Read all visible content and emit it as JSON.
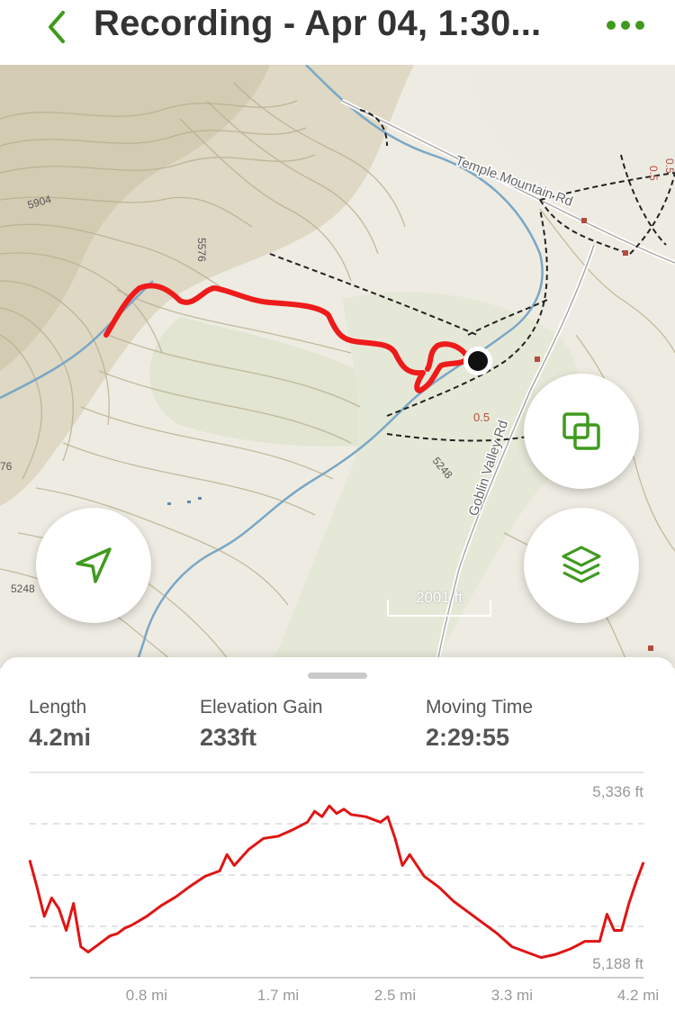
{
  "header": {
    "title": "Recording - Apr 04, 1:30...",
    "accent": "#3f9a1e"
  },
  "map": {
    "labels": {
      "road1": "Temple Mountain Rd",
      "road2": "Goblin Valley Rd",
      "elev1": "5904",
      "elev2": "5576",
      "elev3": "5248",
      "elev4": "5248",
      "elev5": "76",
      "trail_mile1": "0.5",
      "trail_mile2": "0.5",
      "trail_mile3": "0.5"
    },
    "scale": "2001 ft",
    "track_color": "#ee1b1b"
  },
  "stats": [
    {
      "label": "Length",
      "value": "4.2mi"
    },
    {
      "label": "Elevation Gain",
      "value": "233ft"
    },
    {
      "label": "Moving Time",
      "value": "2:29:55"
    }
  ],
  "chart_data": {
    "type": "line",
    "title": "",
    "xlabel": "",
    "ylabel": "",
    "x_ticks": [
      "0.8 mi",
      "1.7 mi",
      "2.5 mi",
      "3.3 mi",
      "4.2 mi"
    ],
    "y_ticks": [
      "5,336 ft",
      "5,188 ft"
    ],
    "ylim": [
      5188,
      5336
    ],
    "xlim": [
      0,
      4.2
    ],
    "series": [
      {
        "x": [
          0,
          0.05,
          0.1,
          0.15,
          0.2,
          0.25,
          0.3,
          0.35,
          0.4,
          0.45,
          0.5,
          0.55,
          0.6,
          0.65,
          0.7,
          0.8,
          0.9,
          1.0,
          1.1,
          1.2,
          1.3,
          1.35,
          1.4,
          1.5,
          1.6,
          1.7,
          1.8,
          1.9,
          1.95,
          2.0,
          2.05,
          2.1,
          2.15,
          2.2,
          2.3,
          2.4,
          2.45,
          2.5,
          2.55,
          2.6,
          2.7,
          2.8,
          2.9,
          3.0,
          3.1,
          3.2,
          3.3,
          3.4,
          3.5,
          3.6,
          3.7,
          3.8,
          3.9,
          3.95,
          4.0,
          4.05,
          4.1,
          4.15,
          4.2
        ],
        "y": [
          5280,
          5255,
          5228,
          5245,
          5235,
          5215,
          5240,
          5200,
          5195,
          5200,
          5205,
          5210,
          5212,
          5217,
          5220,
          5228,
          5238,
          5246,
          5256,
          5265,
          5270,
          5285,
          5275,
          5290,
          5300,
          5302,
          5308,
          5315,
          5325,
          5320,
          5330,
          5323,
          5327,
          5322,
          5320,
          5315,
          5320,
          5300,
          5275,
          5285,
          5265,
          5255,
          5242,
          5232,
          5222,
          5212,
          5200,
          5195,
          5190,
          5193,
          5198,
          5205,
          5205,
          5230,
          5215,
          5215,
          5240,
          5260,
          5278
        ]
      }
    ],
    "grid": true,
    "color": "#e01414"
  }
}
